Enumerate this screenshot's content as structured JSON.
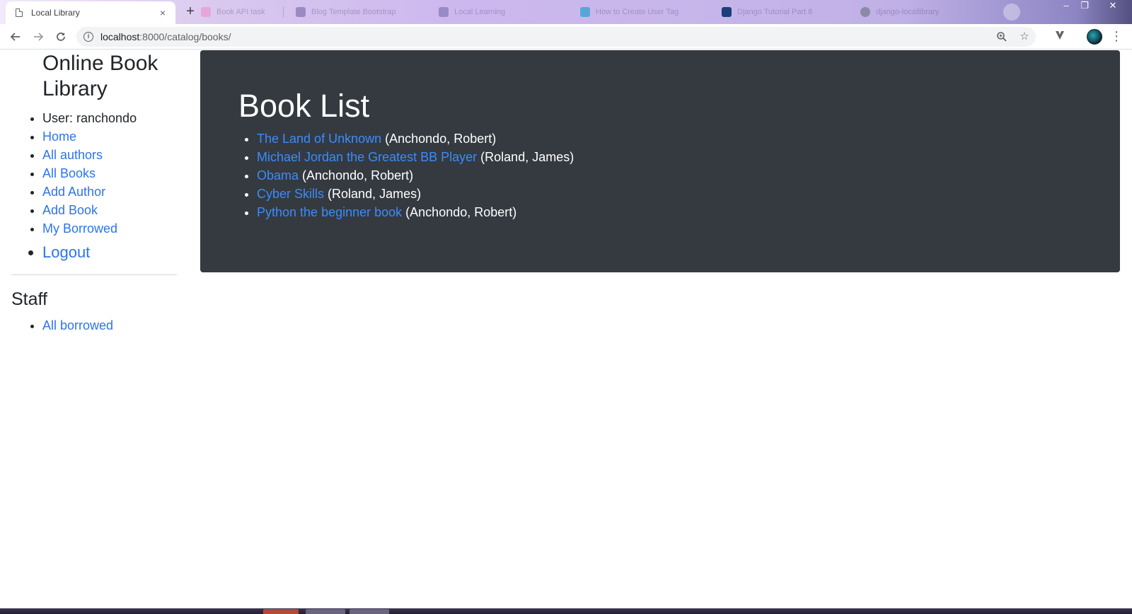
{
  "browser": {
    "active_tab_title": "Local Library",
    "close_glyph": "×",
    "new_tab_glyph": "+",
    "background_tabs": [
      {
        "label": "Book API task",
        "favicon_color": "#e8a5d8"
      },
      {
        "label": "Blog Template Bootstrap",
        "favicon_color": "#9a8ac4"
      },
      {
        "label": "Local Learning",
        "favicon_color": "#9a8ac4"
      },
      {
        "label": "How to Create User Tag",
        "favicon_color": "#58a6d8"
      },
      {
        "label": "Django Tutorial Part 8",
        "favicon_color": "#1b3f7a"
      },
      {
        "label": "django-locallibrary",
        "favicon_color": "#8a8aa8"
      }
    ],
    "url_host": "localhost",
    "url_path": ":8000/catalog/books/",
    "window_controls": {
      "minimize": "–",
      "restore": "❐",
      "close": "✕"
    },
    "icons": {
      "back": "arrow-left-icon",
      "forward": "arrow-right-icon",
      "reload": "reload-icon",
      "site_info": "info-icon",
      "zoom": "zoom-icon",
      "bookmark": "star-icon",
      "extension": "extension-icon",
      "menu": "more-vert-icon"
    }
  },
  "sidebar": {
    "brand": "Online Book Library",
    "user_text": "User: ranchondo",
    "links": [
      {
        "label": "Home"
      },
      {
        "label": "All authors"
      },
      {
        "label": "All Books"
      },
      {
        "label": "Add Author"
      },
      {
        "label": "Add Book"
      },
      {
        "label": "My Borrowed"
      }
    ],
    "logout_label": "Logout",
    "staff_heading": "Staff",
    "staff_links": [
      {
        "label": "All borrowed"
      }
    ]
  },
  "main": {
    "heading": "Book List",
    "books": [
      {
        "title": "The Land of Unknown",
        "author": "(Anchondo, Robert)"
      },
      {
        "title": "Michael Jordan the Greatest BB Player",
        "author": "(Roland, James)"
      },
      {
        "title": "Obama",
        "author": "(Anchondo, Robert)"
      },
      {
        "title": "Cyber Skills",
        "author": "(Roland, James)"
      },
      {
        "title": "Python the beginner book",
        "author": "(Anchondo, Robert)"
      }
    ]
  },
  "colors": {
    "link": "#2b74f0",
    "jumbotron_bg": "#343a40",
    "jumbotron_link": "#3b8bff",
    "text": "#212529"
  }
}
